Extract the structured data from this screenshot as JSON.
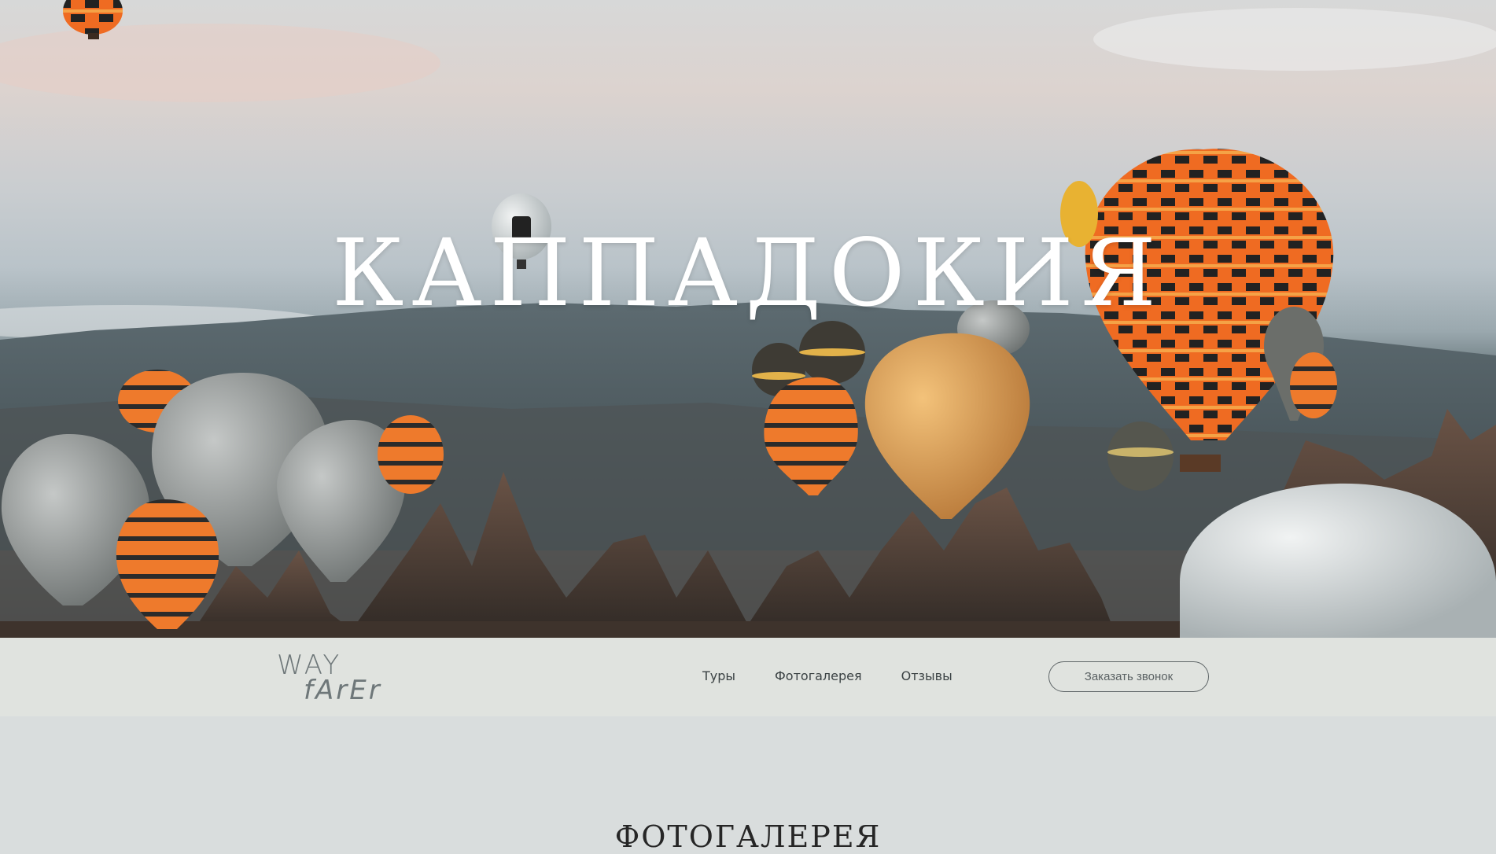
{
  "hero": {
    "title": "КАППАДОКИЯ"
  },
  "header": {
    "logo_line1": "WAY",
    "logo_line2": "fArEr",
    "nav": [
      "Туры",
      "Фотогалерея",
      "Отзывы"
    ],
    "call_button": "Заказать звонок"
  },
  "gallery": {
    "title": "ФОТОГАЛЕРЕЯ"
  },
  "colors": {
    "navbar_bg": "#e0e3df",
    "page_bg": "#d9dddd",
    "balloon_orange": "#e8702a"
  }
}
